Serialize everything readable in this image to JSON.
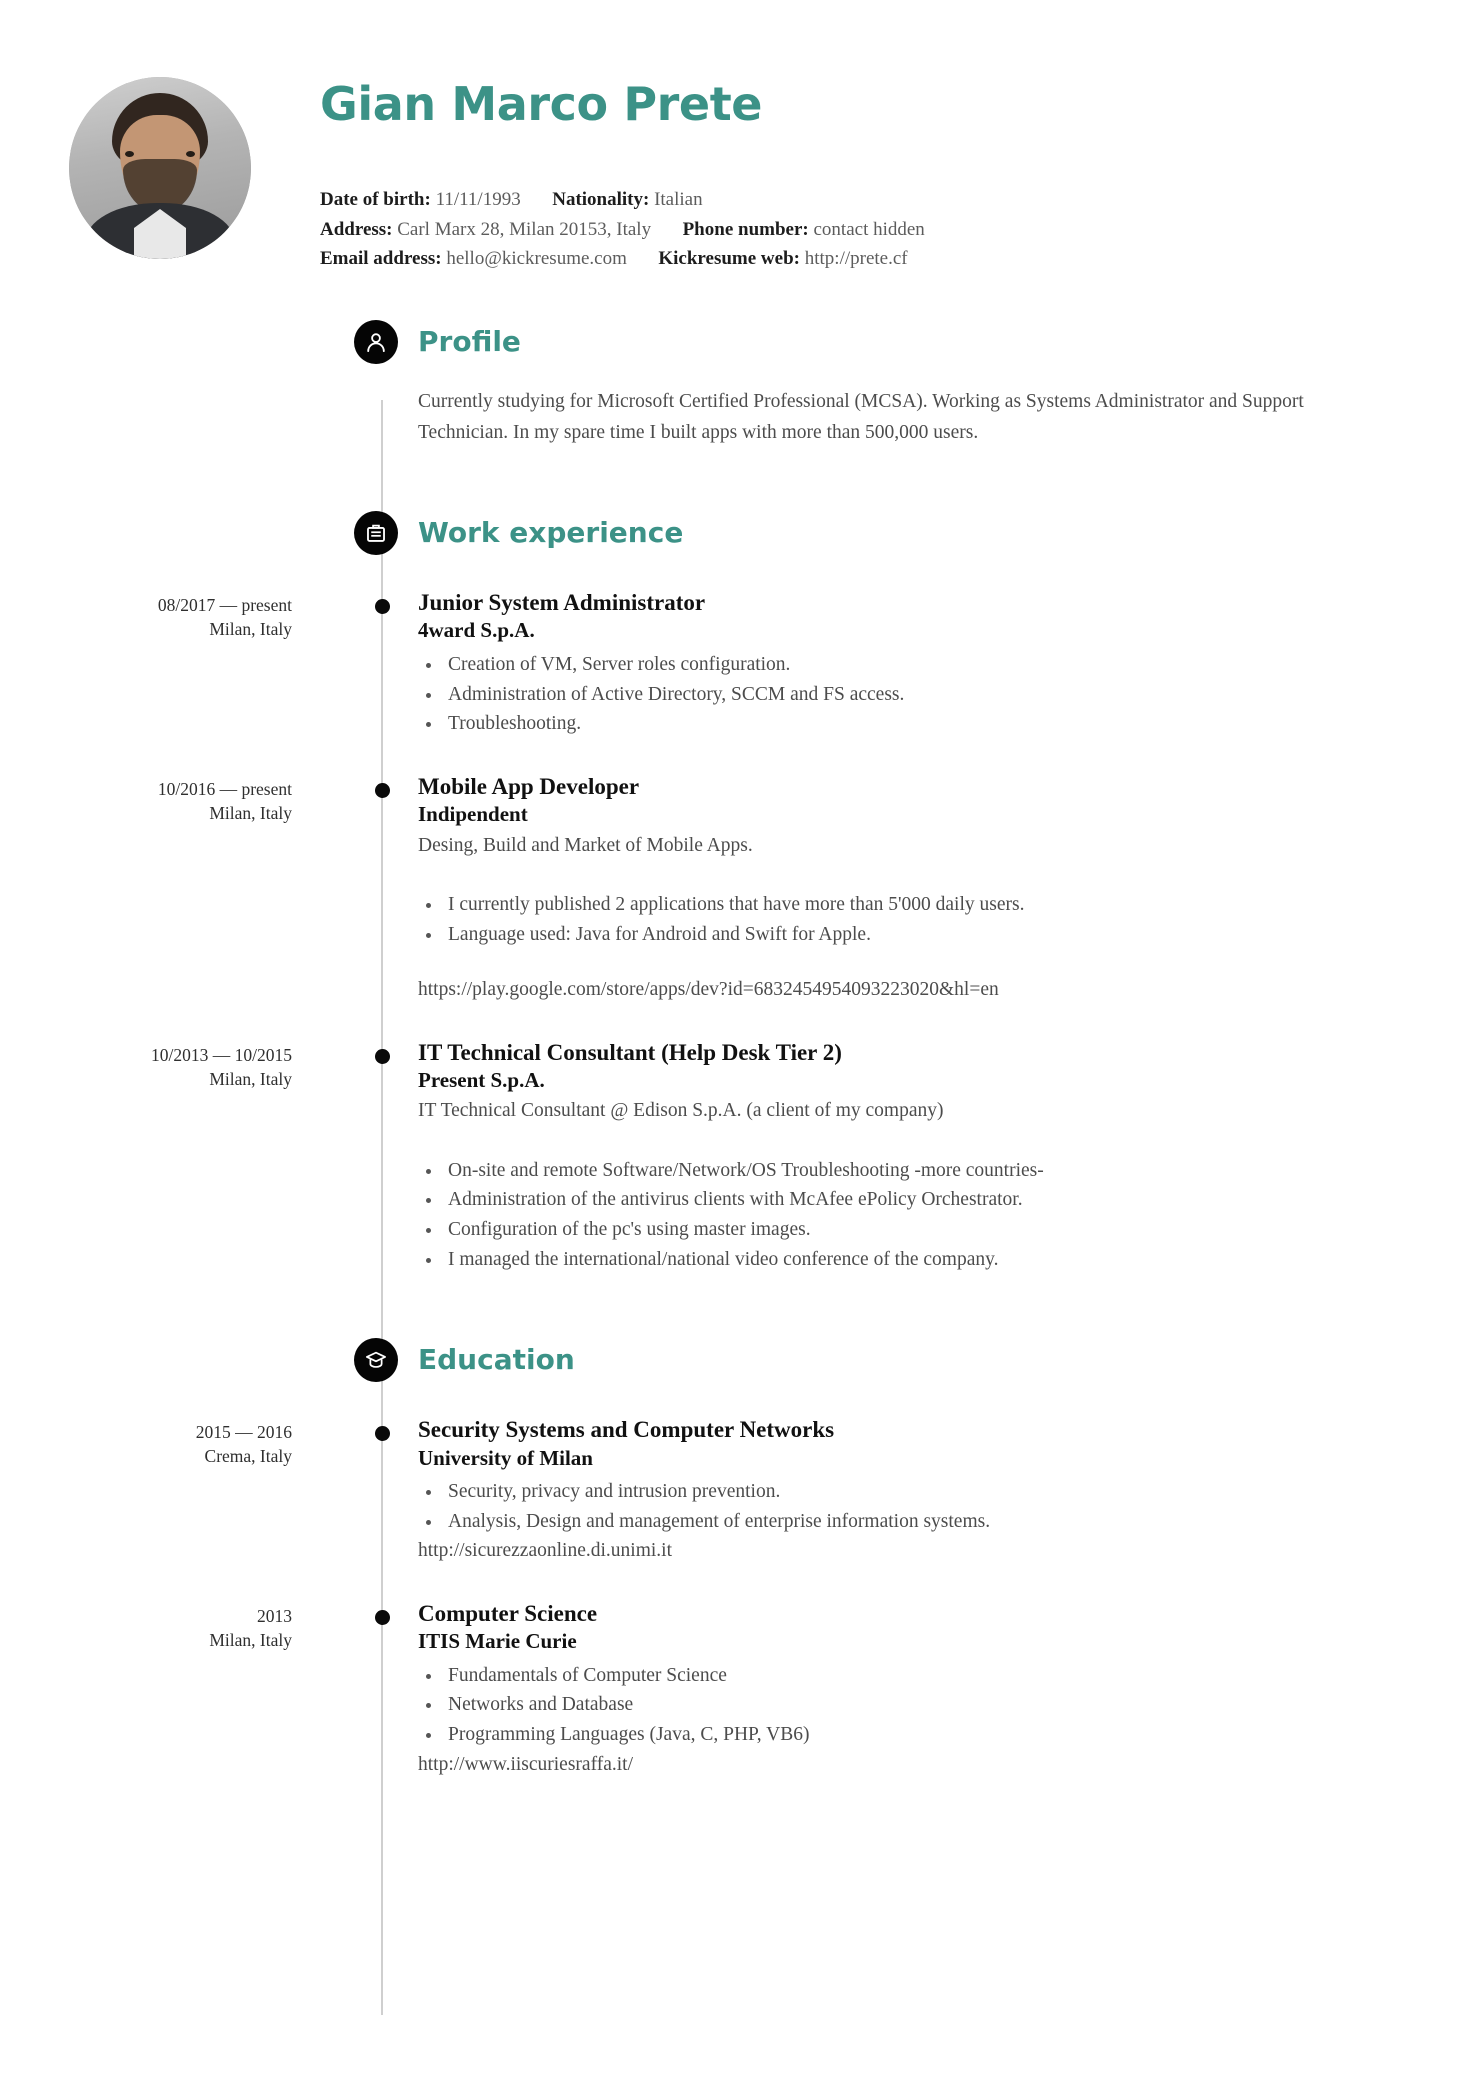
{
  "theme": {
    "accent": "#3c9287",
    "icon_bg": "#050505",
    "text": "#4c4c4c",
    "heading": "#111111",
    "spine": "#cfcfcf"
  },
  "header": {
    "name": "Gian Marco Prete",
    "avatar_alt": "profile-photo",
    "contact": {
      "rows": [
        [
          {
            "label": "Date of birth:",
            "value": "11/11/1993"
          },
          {
            "label": "Nationality:",
            "value": "Italian"
          }
        ],
        [
          {
            "label": "Address:",
            "value": "Carl Marx 28, Milan 20153, Italy"
          },
          {
            "label": "Phone number:",
            "value": "contact hidden"
          }
        ],
        [
          {
            "label": "Email address:",
            "value": "hello@kickresume.com"
          },
          {
            "label": "Kickresume web:",
            "value": "http://prete.cf"
          }
        ]
      ]
    }
  },
  "sections": {
    "profile": {
      "title": "Profile",
      "icon": "person-icon",
      "text": "Currently studying for Microsoft Certified Professional (MCSA). Working as Systems Administrator and Support Technician. In my spare time I built apps with more than 500,000 users."
    },
    "work": {
      "title": "Work experience",
      "icon": "briefcase-icon",
      "entries": [
        {
          "date": "08/2017 — present",
          "location": "Milan, Italy",
          "title": "Junior System Administrator",
          "org": "4ward S.p.A.",
          "subtitle": "",
          "bullets": [
            "Creation of VM, Server roles configuration.",
            "Administration of Active Directory, SCCM and FS access.",
            "Troubleshooting."
          ],
          "link": ""
        },
        {
          "date": "10/2016 — present",
          "location": "Milan, Italy",
          "title": "Mobile App Developer",
          "org": "Indipendent",
          "subtitle": "Desing, Build and Market of Mobile Apps.",
          "bullets": [
            "I currently published 2 applications that have more than 5'000 daily users.",
            "Language used: Java for Android and Swift for Apple."
          ],
          "link": "https://play.google.com/store/apps/dev?id=6832454954093223020&hl=en"
        },
        {
          "date": "10/2013 — 10/2015",
          "location": "Milan, Italy",
          "title": "IT Technical Consultant (Help Desk Tier 2)",
          "org": "Present S.p.A.",
          "subtitle": "IT Technical Consultant @ Edison S.p.A. (a client of my company)",
          "bullets": [
            "On-site and remote Software/Network/OS Troubleshooting -more countries-",
            "Administration of the antivirus clients with McAfee ePolicy Orchestrator.",
            "Configuration of the pc's using master images.",
            "I managed the international/national video conference of the company."
          ],
          "link": ""
        }
      ]
    },
    "education": {
      "title": "Education",
      "icon": "graduation-cap-icon",
      "entries": [
        {
          "date": "2015 — 2016",
          "location": "Crema, Italy",
          "title": "Security Systems and Computer Networks",
          "org": "University of Milan",
          "subtitle": "",
          "bullets": [
            "Security, privacy and intrusion prevention.",
            "Analysis, Design and management of enterprise information systems."
          ],
          "link": "http://sicurezzaonline.di.unimi.it"
        },
        {
          "date": "2013",
          "location": "Milan, Italy",
          "title": "Computer Science",
          "org": "ITIS Marie Curie",
          "subtitle": "",
          "bullets": [
            "Fundamentals of Computer Science",
            "Networks and Database",
            "Programming Languages (Java, C, PHP, VB6)"
          ],
          "link": "http://www.iiscuriesraffa.it/"
        }
      ]
    }
  }
}
